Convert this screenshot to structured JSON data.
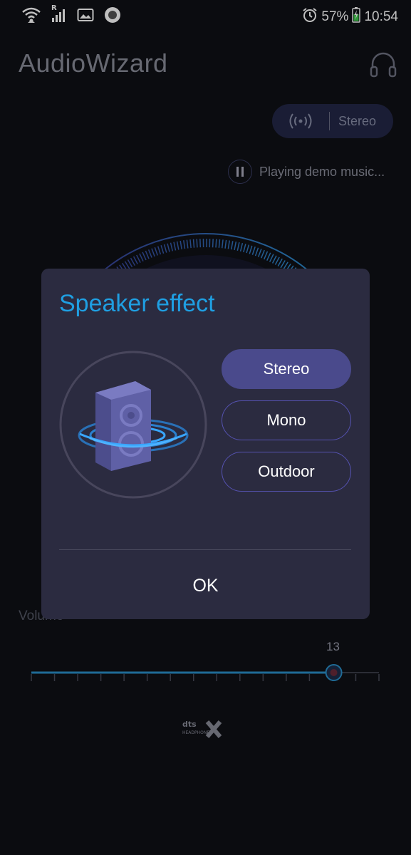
{
  "status_bar": {
    "battery": "57%",
    "time": "10:54",
    "roaming_indicator": "R",
    "icons": [
      "wifi-icon",
      "signal-icon",
      "image-icon",
      "record-icon",
      "alarm-icon",
      "battery-charging-icon"
    ]
  },
  "app": {
    "title": "AudioWizard",
    "mode_label": "Stereo",
    "playing_text": "Playing demo music...",
    "volume_label": "Volume",
    "volume_value": "13",
    "volume_level": 0.87,
    "logo_text": "dts HEADPHONE X"
  },
  "dialog": {
    "title": "Speaker effect",
    "options": [
      {
        "label": "Stereo",
        "selected": true
      },
      {
        "label": "Mono",
        "selected": false
      },
      {
        "label": "Outdoor",
        "selected": false
      }
    ],
    "ok_label": "OK"
  },
  "colors": {
    "accent": "#1f9fe2",
    "selected": "#4a4a8c",
    "dialog_bg": "#2b2b40"
  }
}
